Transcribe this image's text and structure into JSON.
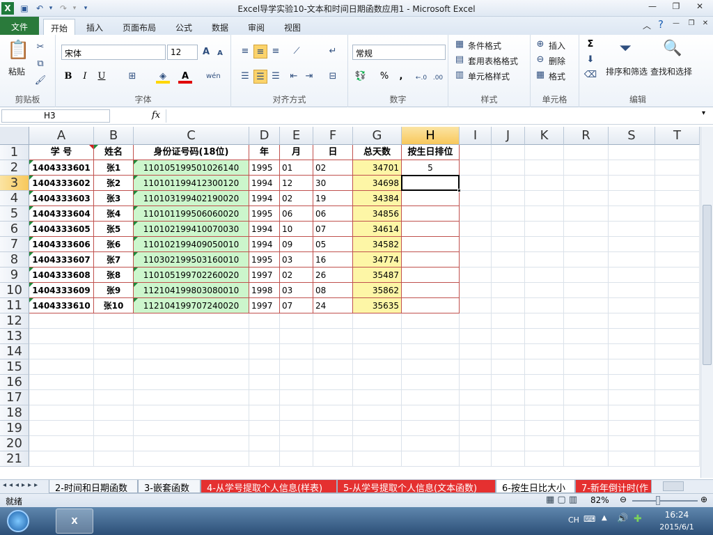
{
  "window": {
    "title": "Excel导学实验10-文本和时间日期函数应用1  -  Microsoft Excel",
    "app_icon": "X"
  },
  "quick_access": {
    "save_icon": "save-icon",
    "undo_icon": "undo-icon",
    "redo_icon": "redo-icon",
    "customize_icon": "dropdown-icon"
  },
  "ribbon_tabs": [
    "文件",
    "开始",
    "插入",
    "页面布局",
    "公式",
    "数据",
    "审阅",
    "视图"
  ],
  "active_tab": "开始",
  "clipboard": {
    "paste": "粘贴",
    "label": "剪贴板"
  },
  "font": {
    "name": "宋体",
    "size": "12",
    "bold": "B",
    "italic": "I",
    "underline": "U",
    "label": "字体",
    "grow": "A",
    "shrink": "A",
    "fill_color": "#ffd700",
    "font_color": "#e00000",
    "phonetic": "wén"
  },
  "alignment": {
    "label": "对齐方式"
  },
  "number": {
    "format": "常规",
    "percent": "%",
    "comma": ",",
    "inc_decimal": "←.0 .00",
    "dec_decimal": ".00 →.0",
    "label": "数字"
  },
  "styles": {
    "conditional": "条件格式",
    "table": "套用表格格式",
    "cell_styles": "单元格样式",
    "label": "样式"
  },
  "cells": {
    "insert": "插入",
    "delete": "删除",
    "format": "格式",
    "label": "单元格"
  },
  "editing": {
    "sum": "Σ",
    "sort_filter": "排序和筛选",
    "find_select": "查找和选择",
    "label": "编辑"
  },
  "formula_bar": {
    "name_box": "H3",
    "fx": "fx",
    "formula": ""
  },
  "columns": [
    "A",
    "B",
    "C",
    "D",
    "E",
    "F",
    "G",
    "H",
    "I",
    "J",
    "K",
    "R",
    "S",
    "T"
  ],
  "rows": [
    "1",
    "2",
    "3",
    "4",
    "5",
    "6",
    "7",
    "8",
    "9",
    "10",
    "11",
    "12",
    "13",
    "14",
    "15",
    "16",
    "17",
    "18",
    "19",
    "20",
    "21"
  ],
  "headers": [
    "学    号",
    "姓名",
    "身份证号码(18位)",
    "年",
    "月",
    "日",
    "总天数",
    "按生日排位"
  ],
  "table": [
    [
      "1404333601",
      "张1",
      "110105199501026140",
      "1995",
      "01",
      "02",
      "34701",
      "5"
    ],
    [
      "1404333602",
      "张2",
      "110101199412300120",
      "1994",
      "12",
      "30",
      "34698",
      ""
    ],
    [
      "1404333603",
      "张3",
      "110103199402190020",
      "1994",
      "02",
      "19",
      "34384",
      ""
    ],
    [
      "1404333604",
      "张4",
      "110101199506060020",
      "1995",
      "06",
      "06",
      "34856",
      ""
    ],
    [
      "1404333605",
      "张5",
      "110102199410070030",
      "1994",
      "10",
      "07",
      "34614",
      ""
    ],
    [
      "1404333606",
      "张6",
      "110102199409050010",
      "1994",
      "09",
      "05",
      "34582",
      ""
    ],
    [
      "1404333607",
      "张7",
      "110302199503160010",
      "1995",
      "03",
      "16",
      "34774",
      ""
    ],
    [
      "1404333608",
      "张8",
      "110105199702260020",
      "1997",
      "02",
      "26",
      "35487",
      ""
    ],
    [
      "1404333609",
      "张9",
      "112104199803080010",
      "1998",
      "03",
      "08",
      "35862",
      ""
    ],
    [
      "1404333610",
      "张10",
      "112104199707240020",
      "1997",
      "07",
      "24",
      "35635",
      ""
    ]
  ],
  "sheet_tabs": [
    "2-时间和日期函数",
    "3-嵌套函数",
    "4-从学号提取个人信息(样表)",
    "5-从学号提取个人信息(文本函数)",
    "6-按生日比大小",
    "7-新年倒计时(作"
  ],
  "active_sheet": "6-按生日比大小",
  "status": {
    "ready": "就绪",
    "zoom": "82%"
  },
  "taskbar": {
    "lang": "CH",
    "time": "16:24",
    "date": "2015/6/1"
  }
}
